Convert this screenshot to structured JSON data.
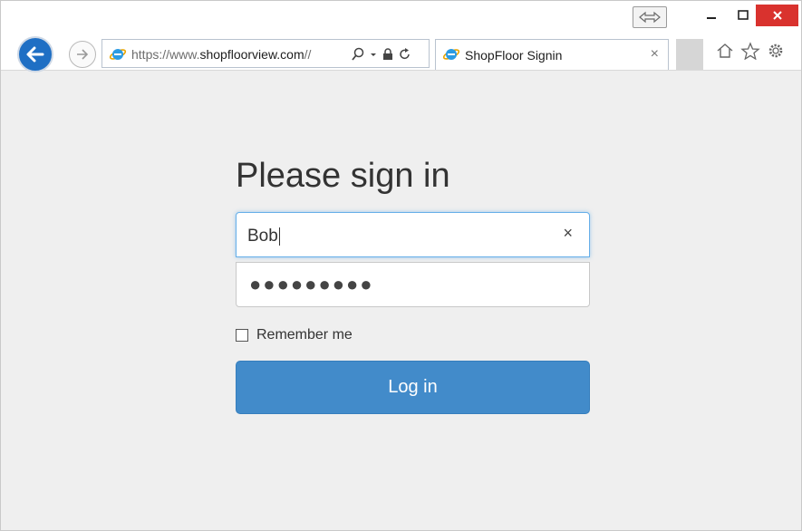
{
  "browser": {
    "url_prefix": "https://www.",
    "url_domain": "shopfloorview.com",
    "url_suffix": "//",
    "tab_title": "ShopFloor Signin",
    "tab_close": "×",
    "address_icons": [
      "search-icon",
      "dropdown-icon",
      "lock-icon",
      "refresh-icon"
    ],
    "toolbar_icons": [
      "home-icon",
      "favorites-star-icon",
      "settings-gear-icon"
    ]
  },
  "form": {
    "heading": "Please sign in",
    "username_value": "Bob",
    "clear_symbol": "×",
    "password_masked": "●●●●●●●●●",
    "remember_label": "Remember me",
    "remember_checked": false,
    "login_label": "Log in"
  },
  "colors": {
    "accent": "#428bca",
    "close_button": "#d9322e",
    "back_button": "#1f6fc4",
    "focus_border": "#66afe9",
    "page_background": "#efefef"
  }
}
